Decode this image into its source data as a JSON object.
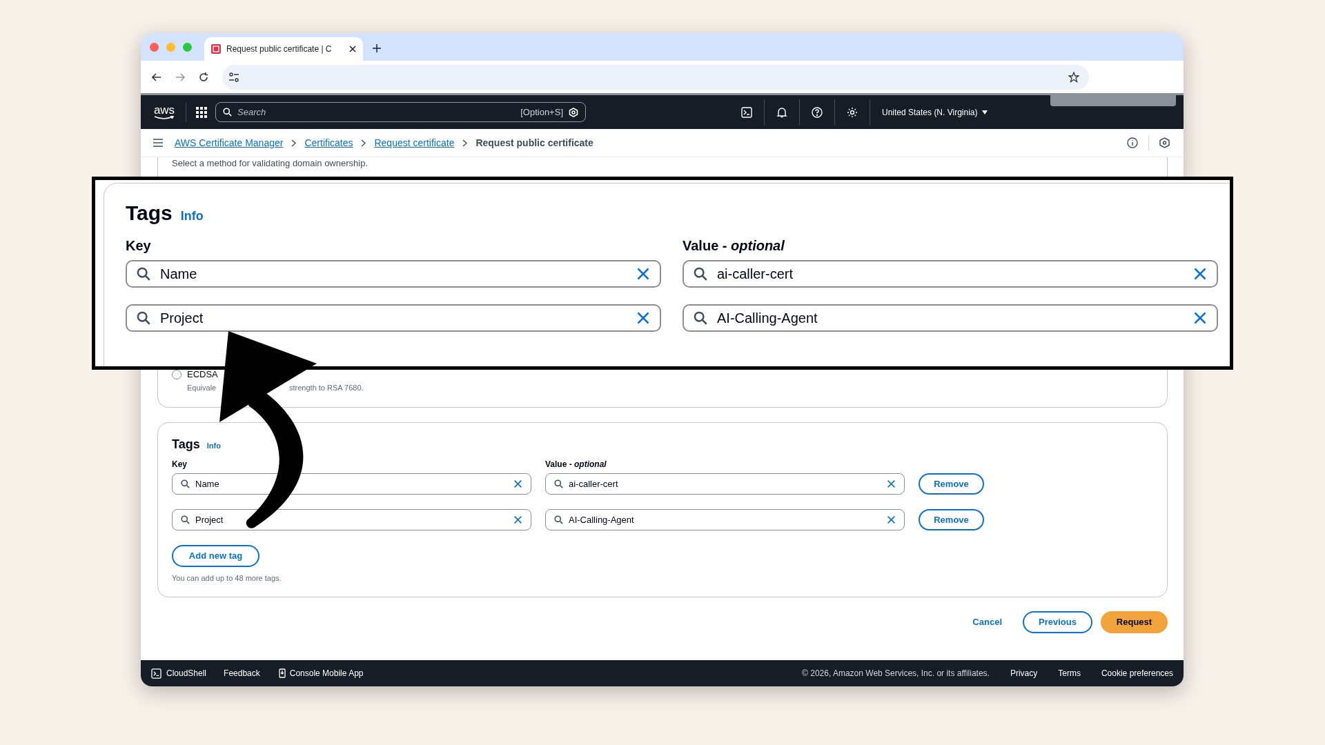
{
  "browser": {
    "tab_title": "Request public certificate | C",
    "tab_selected": true
  },
  "nav": {
    "logo": "aws",
    "search_placeholder": "Search",
    "shortcut": "[Option+S]",
    "region": "United States (N. Virginia)"
  },
  "breadcrumbs": [
    {
      "label": "AWS Certificate Manager",
      "kind": "link"
    },
    {
      "label": "Certificates",
      "kind": "link"
    },
    {
      "label": "Request certificate",
      "kind": "link"
    },
    {
      "label": "Request public certificate",
      "kind": "current"
    }
  ],
  "intro_text": "Select a method for validating domain ownership.",
  "callout": {
    "title": "Tags",
    "info": "Info",
    "key_label": "Key",
    "value_label": "Value - *optional*",
    "rows": [
      {
        "key": "Name",
        "value": "ai-caller-cert"
      },
      {
        "key": "Project",
        "value": "AI-Calling-Agent"
      }
    ]
  },
  "algorithm": {
    "option": "ECDSA",
    "selected": false,
    "description_start": "Equivale",
    "description_end": "strength to RSA 7680."
  },
  "tags": {
    "title": "Tags",
    "info": "Info",
    "key_label": "Key",
    "value_label": "Value - *optional*",
    "rows": [
      {
        "key": "Name",
        "value": "ai-caller-cert",
        "remove": "Remove"
      },
      {
        "key": "Project",
        "value": "AI-Calling-Agent",
        "remove": "Remove"
      }
    ],
    "add_button": "Add new tag",
    "hint": "You can add up to 48 more tags."
  },
  "actions": [
    {
      "label": "Cancel",
      "kind": "link"
    },
    {
      "label": "Previous",
      "kind": "secondary"
    },
    {
      "label": "Request",
      "kind": "primary"
    }
  ],
  "footer": {
    "left": [
      "CloudShell",
      "Feedback",
      "Console Mobile App"
    ],
    "copyright": "© 2026, Amazon Web Services, Inc. or its affiliates.",
    "links": [
      "Privacy",
      "Terms",
      "Cookie preferences"
    ]
  }
}
